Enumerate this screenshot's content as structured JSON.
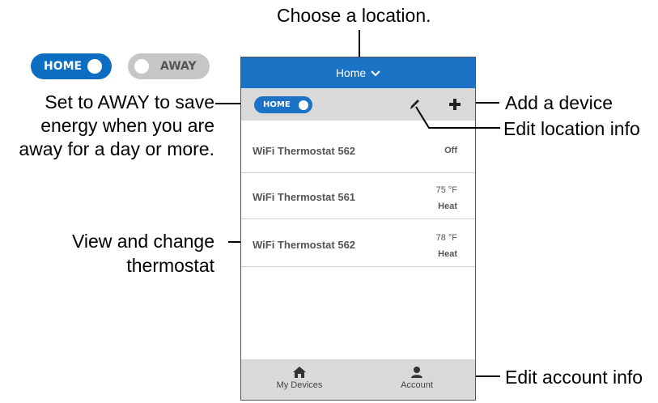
{
  "callouts": {
    "choose_location": "Choose a location.",
    "set_away_1": "Set to AWAY to save",
    "set_away_2": "energy when you are",
    "set_away_3": "away for a day or more.",
    "add_device": "Add a device",
    "edit_location": "Edit location info",
    "view_change_1": "View and change",
    "view_change_2": "thermostat",
    "edit_account": "Edit account info"
  },
  "legend_toggles": {
    "home_label": "HOME",
    "away_label": "AWAY"
  },
  "app": {
    "location": "Home",
    "mode_toggle_label": "HOME",
    "devices": [
      {
        "name": "WiFi Thermostat 562",
        "temp": "",
        "mode": "Off"
      },
      {
        "name": "WiFi Thermostat 561",
        "temp": "75 °F",
        "mode": "Heat"
      },
      {
        "name": "WiFi Thermostat 562",
        "temp": "78 °F",
        "mode": "Heat"
      }
    ],
    "tabs": {
      "my_devices": "My Devices",
      "account": "Account"
    }
  },
  "colors": {
    "brand_blue": "#1c72c4",
    "bar_gray": "#d9d9d9",
    "away_gray": "#c6c6c6"
  },
  "icons": [
    "chevron-down-icon",
    "pencil-icon",
    "plus-icon",
    "home-icon",
    "user-icon"
  ]
}
